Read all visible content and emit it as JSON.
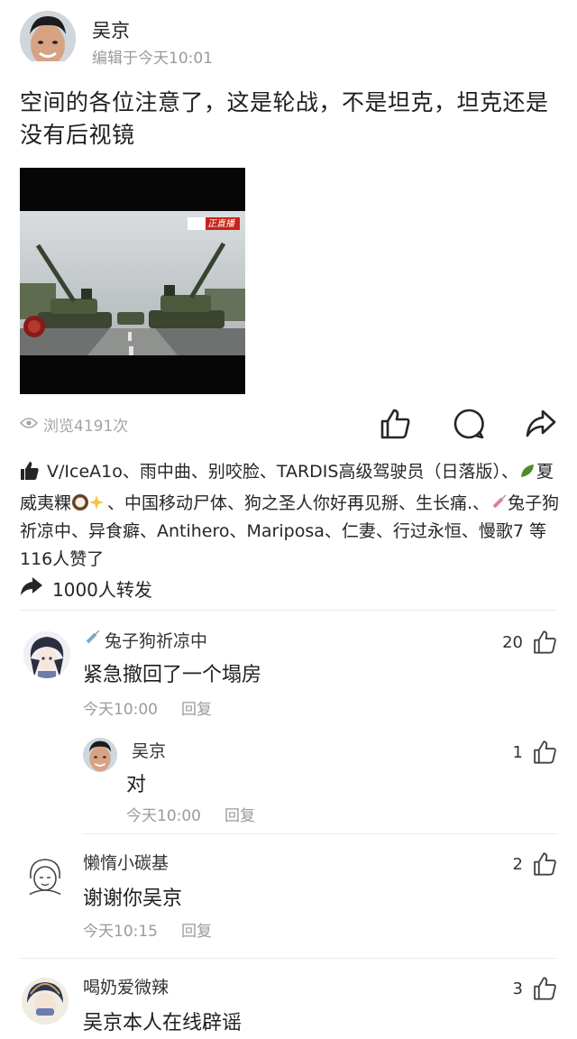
{
  "post": {
    "author": "吴京",
    "meta": "编辑于今天10:01",
    "text": "空间的各位注意了，这是轮战，不是坦克，坦克还是没有后视镜",
    "video_badge": "正直播"
  },
  "stats": {
    "views": "浏览4191次",
    "icons": [
      "eye-icon",
      "thumb-up-icon",
      "comment-icon",
      "share-icon"
    ]
  },
  "likes": {
    "part1": "V/IceA1o、雨中曲、别咬脸、TARDIS高级驾驶员（日落版）、",
    "part2": "夏威夷粿",
    "part3": "、中国移动尸体、狗之圣人你好再见掰、生长痛.、",
    "part4": "兔子狗祈凉中、异食癖、Antihero、Mariposa、仁妻、行过永恒、慢歌7 等116人赞了"
  },
  "shares": {
    "text": "1000人转发"
  },
  "comments": [
    {
      "name": "兔子狗祈凉中",
      "text": "紧急撤回了一个塌房",
      "time": "今天10:00",
      "reply": "回复",
      "likes": "20"
    },
    {
      "name": "吴京",
      "text": "对",
      "time": "今天10:00",
      "reply": "回复",
      "likes": "1"
    },
    {
      "name": "懒惰小碳基",
      "text": "谢谢你吴京",
      "time": "今天10:15",
      "reply": "回复",
      "likes": "2"
    },
    {
      "name": "喝奶爱微辣",
      "text": "吴京本人在线辟谣",
      "likes": "3"
    }
  ],
  "colors": {
    "meta_gray": "#9a9a9a",
    "text": "#1f1f1f",
    "icon": "#262626"
  }
}
